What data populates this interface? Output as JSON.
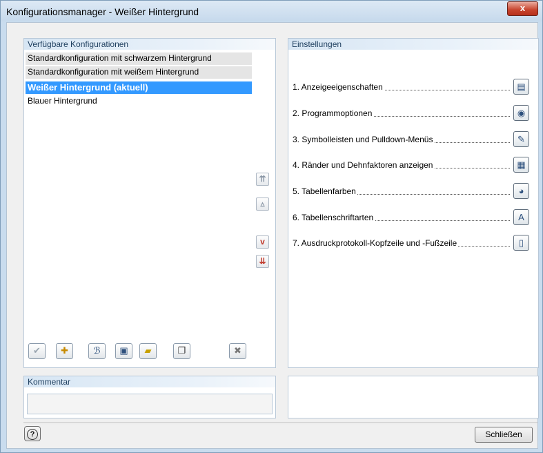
{
  "window": {
    "title": "Konfigurationsmanager - Weißer Hintergrund",
    "close_glyph": "x"
  },
  "configs": {
    "header": "Verfügbare Konfigurationen",
    "items": [
      {
        "label": "Standardkonfiguration mit schwarzem Hintergrund",
        "state": "default"
      },
      {
        "label": "Standardkonfiguration mit weißem Hintergrund",
        "state": "default"
      },
      {
        "label": "Weißer Hintergrund (aktuell)",
        "state": "selected"
      },
      {
        "label": "Blauer Hintergrund",
        "state": "normal"
      }
    ]
  },
  "move_buttons": [
    {
      "name": "move-top",
      "icon": "double-up-icon",
      "glyph": "⇈"
    },
    {
      "name": "move-up",
      "icon": "up-icon",
      "glyph": "▵"
    },
    {
      "name": "move-down",
      "icon": "down-icon",
      "glyph": "v"
    },
    {
      "name": "move-bottom",
      "icon": "double-down-icon",
      "glyph": "⇊"
    }
  ],
  "toolbar": [
    {
      "name": "apply",
      "icon": "checkmark-icon",
      "glyph": "✔"
    },
    {
      "name": "new",
      "icon": "new-config-icon",
      "glyph": "✚"
    },
    {
      "name": "rename",
      "icon": "rename-icon",
      "glyph": "ℬ"
    },
    {
      "name": "save",
      "icon": "save-icon",
      "glyph": "▣"
    },
    {
      "name": "open",
      "icon": "open-folder-icon",
      "glyph": "▰"
    },
    {
      "name": "copy",
      "icon": "copy-icon",
      "glyph": "❐"
    },
    {
      "name": "delete",
      "icon": "delete-icon",
      "glyph": "✖"
    }
  ],
  "settings": {
    "header": "Einstellungen",
    "items": [
      {
        "label": "1. Anzeigeeigenschaften",
        "icon": "display-properties-icon"
      },
      {
        "label": "2. Programmoptionen",
        "icon": "program-options-icon"
      },
      {
        "label": "3. Symbolleisten und Pulldown-Menüs",
        "icon": "toolbars-icon"
      },
      {
        "label": "4. Ränder und Dehnfaktoren anzeigen",
        "icon": "margins-icon"
      },
      {
        "label": "5. Tabellenfarben",
        "icon": "table-colors-icon"
      },
      {
        "label": "6. Tabellenschriftarten",
        "icon": "table-fonts-icon"
      },
      {
        "label": "7. Ausdruckprotokoll-Kopfzeile und -Fußzeile",
        "icon": "header-footer-icon"
      }
    ]
  },
  "comment": {
    "header": "Kommentar",
    "value": ""
  },
  "footer": {
    "help_glyph": "?",
    "close_label": "Schließen"
  },
  "colors": {
    "selection": "#3399ff",
    "accent_red": "#c0392b"
  }
}
